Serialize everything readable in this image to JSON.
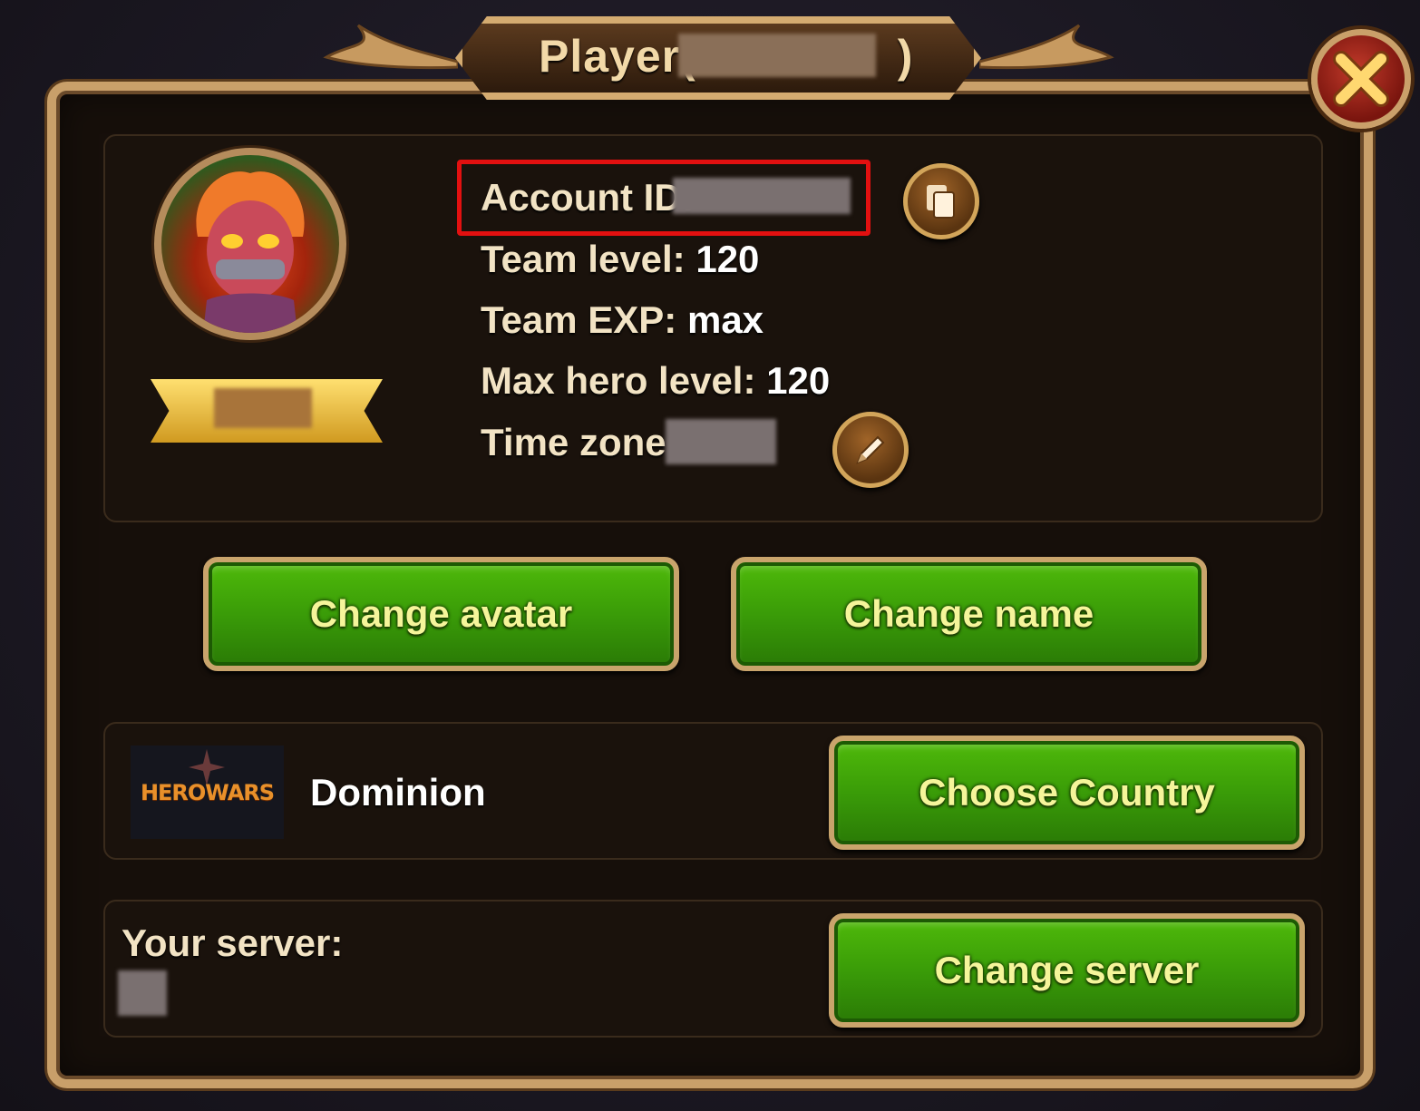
{
  "dialog": {
    "title_prefix": "Player(",
    "title_suffix": ")"
  },
  "profile": {
    "account_id_label": "Account ID:",
    "team_level_label": "Team level:",
    "team_level_value": "120",
    "team_exp_label": "Team EXP:",
    "team_exp_value": "max",
    "max_hero_level_label": "Max hero level:",
    "max_hero_level_value": "120",
    "time_zone_label": "Time zone:"
  },
  "buttons": {
    "change_avatar": "Change avatar",
    "change_name": "Change name",
    "choose_country": "Choose Country",
    "change_server": "Change server"
  },
  "guild": {
    "logo_text": "HEROWARS",
    "name": "Dominion"
  },
  "server": {
    "label": "Your server:"
  },
  "icons": {
    "close": "close-x-icon",
    "copy": "copy-icon",
    "edit": "pencil-icon"
  },
  "colors": {
    "button_green": "#3a9c08",
    "button_text": "#f5f59a",
    "highlight_red": "#e21010",
    "frame_gold": "#c9a06a"
  }
}
